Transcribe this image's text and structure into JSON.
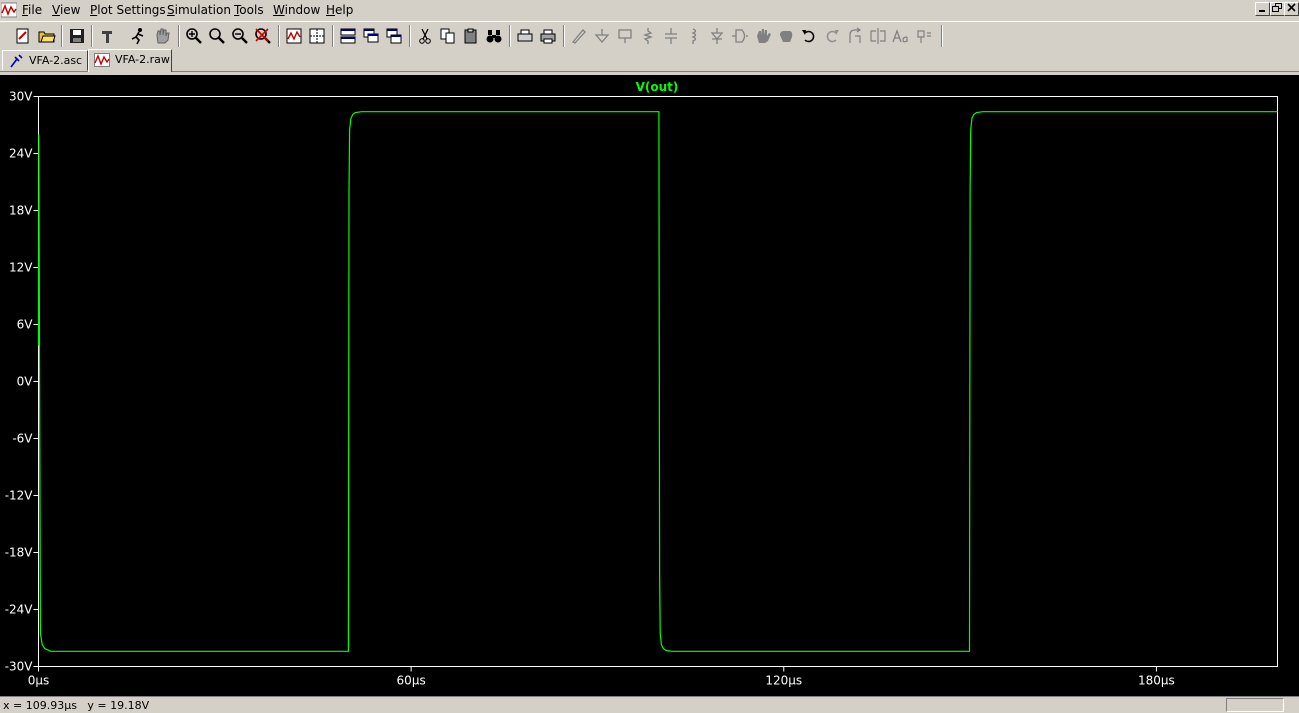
{
  "menubar": {
    "items": [
      "File",
      "View",
      "Plot Settings",
      "Simulation",
      "Tools",
      "Window",
      "Help"
    ]
  },
  "window_buttons": [
    "minimize",
    "restore",
    "close"
  ],
  "toolbar": {
    "buttons": [
      "new-schematic",
      "open",
      "save",
      "control-panel",
      "run",
      "halt",
      "zoom-in",
      "zoom-full",
      "zoom-out",
      "zoom-cancel",
      "autorange",
      "mark-data",
      "tile-horizontal",
      "cascade",
      "tile-vertical",
      "cut",
      "copy",
      "paste",
      "find",
      "print-preview",
      "print",
      "draw-wire",
      "ground",
      "label-net",
      "resistor",
      "capacitor",
      "inductor",
      "diode",
      "component",
      "move",
      "drag",
      "undo",
      "redo",
      "rotate",
      "mirror",
      "text",
      "spice-directive"
    ]
  },
  "tabs": [
    {
      "label": "VFA-2.asc",
      "icon": "schematic-icon",
      "active": false
    },
    {
      "label": "VFA-2.raw",
      "icon": "waveform-icon",
      "active": true
    }
  ],
  "status": {
    "coords": "x = 109.93µs   y = 19.18V"
  },
  "colors": {
    "trace": "#00ff00",
    "plot_bg": "#000000",
    "axis": "#ffffff",
    "chrome": "#d4d0c8"
  },
  "chart_data": {
    "type": "line",
    "title": "",
    "xlabel": "",
    "ylabel": "",
    "xlim": [
      0,
      199.5
    ],
    "ylim": [
      -30,
      30
    ],
    "grid": false,
    "x_ticks": [
      "0µs",
      "60µs",
      "120µs",
      "180µs"
    ],
    "x_tick_values": [
      0,
      60,
      120,
      180
    ],
    "y_ticks": [
      "30V",
      "24V",
      "18V",
      "12V",
      "6V",
      "0V",
      "-6V",
      "-12V",
      "-18V",
      "-24V",
      "-30V"
    ],
    "y_tick_values": [
      30,
      24,
      18,
      12,
      6,
      0,
      -6,
      -12,
      -18,
      -24,
      -30
    ],
    "series": [
      {
        "name": "V(out)",
        "color": "#00ff00",
        "x": [
          0,
          0.05,
          0.3,
          0.6,
          1.0,
          2.0,
          49.9,
          50.0,
          50.1,
          50.3,
          50.6,
          51.0,
          52.0,
          99.9,
          100.0,
          100.1,
          100.3,
          100.6,
          101.0,
          102.0,
          149.9,
          150.0,
          150.1,
          150.3,
          150.6,
          151.0,
          152.0,
          199.5
        ],
        "values": [
          3.8,
          26.0,
          -26.5,
          -27.7,
          -28.1,
          -28.4,
          -28.4,
          20.0,
          26.5,
          27.7,
          28.1,
          28.3,
          28.4,
          28.4,
          -20.0,
          -26.5,
          -27.7,
          -28.1,
          -28.3,
          -28.4,
          -28.4,
          20.0,
          26.5,
          27.7,
          28.1,
          28.3,
          28.4,
          28.4
        ]
      }
    ]
  }
}
